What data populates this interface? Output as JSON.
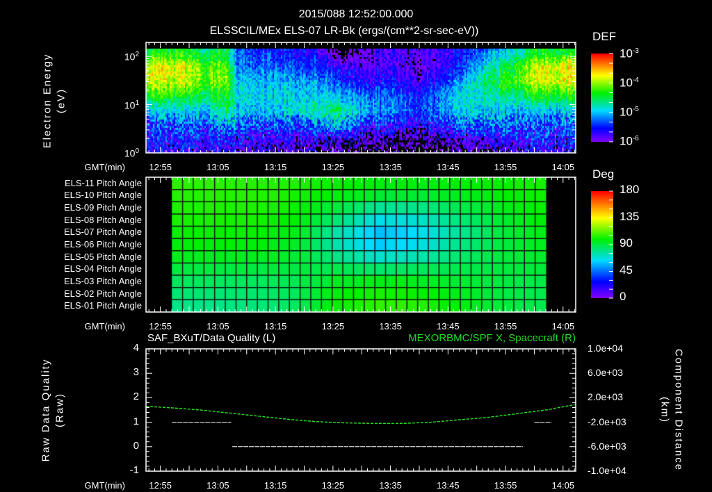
{
  "header": {
    "timestamp": "2015/088 12:52:00.000",
    "title": "ELSSCIL/MEx ELS-07 LR-Bk  (ergs/(cm**2-sr-sec-eV))"
  },
  "time_axis": {
    "label": "GMT(min)",
    "start_min": 0.5,
    "end_min": 75.2,
    "origin": "12:52",
    "ticks": [
      {
        "label": "12:55",
        "min": 3
      },
      {
        "label": "13:05",
        "min": 13
      },
      {
        "label": "13:15",
        "min": 23
      },
      {
        "label": "13:25",
        "min": 33
      },
      {
        "label": "13:35",
        "min": 43
      },
      {
        "label": "13:45",
        "min": 53
      },
      {
        "label": "13:55",
        "min": 63
      },
      {
        "label": "14:05",
        "min": 73
      }
    ]
  },
  "chart_data": [
    {
      "type": "heatmap",
      "name": "electron-spectrogram",
      "ylabel": "Electron Energy",
      "yunit": "(eV)",
      "yscale": "log",
      "ylim_log10": [
        0,
        2.29
      ],
      "yticks": [
        {
          "label": "10",
          "exp": "0",
          "log": 0
        },
        {
          "label": "10",
          "exp": "1",
          "log": 1
        },
        {
          "label": "10",
          "exp": "2",
          "log": 2
        }
      ],
      "data_top_log10E": 2.16,
      "colorbar": {
        "label": "DEF",
        "range_log10": [
          -6,
          -3
        ],
        "ticks": [
          {
            "label": "10",
            "exp": "-3",
            "log": -3
          },
          {
            "label": "10",
            "exp": "-4",
            "log": -4
          },
          {
            "label": "10",
            "exp": "-5",
            "log": -5
          },
          {
            "label": "10",
            "exp": "-6",
            "log": -6
          }
        ]
      },
      "times_min": [
        0,
        6,
        11,
        14.5,
        16,
        23,
        30,
        34,
        38,
        43,
        48,
        55,
        62,
        68,
        75
      ],
      "log10E": [
        0.0,
        0.3,
        0.6,
        0.9,
        1.2,
        1.5,
        1.8,
        2.1
      ],
      "log10_def": [
        [
          -5.8,
          -5.6,
          -5.4,
          -5.0,
          -4.4,
          -3.9,
          -3.8,
          -4.5
        ],
        [
          -5.8,
          -5.6,
          -5.4,
          -5.0,
          -4.4,
          -3.9,
          -3.8,
          -4.4
        ],
        [
          -5.8,
          -5.6,
          -5.4,
          -5.0,
          -4.5,
          -4.2,
          -4.2,
          -4.6
        ],
        [
          -5.8,
          -5.5,
          -5.0,
          -4.5,
          -4.3,
          -4.0,
          -4.1,
          -4.5
        ],
        [
          -5.9,
          -5.7,
          -5.3,
          -5.0,
          -4.9,
          -5.0,
          -5.2,
          -5.3
        ],
        [
          -6.0,
          -5.8,
          -5.4,
          -5.0,
          -4.9,
          -5.0,
          -5.3,
          -5.5
        ],
        [
          -6.1,
          -5.8,
          -5.2,
          -4.7,
          -4.9,
          -5.1,
          -5.4,
          -5.6
        ],
        [
          -6.2,
          -5.9,
          -5.0,
          -4.6,
          -5.0,
          -5.4,
          -5.7,
          -6.3
        ],
        [
          -6.3,
          -6.0,
          -5.5,
          -5.0,
          -5.2,
          -5.6,
          -5.9,
          -6.0
        ],
        [
          -6.4,
          -6.1,
          -5.6,
          -5.2,
          -5.3,
          -5.6,
          -5.8,
          -5.8
        ],
        [
          -6.4,
          -6.2,
          -5.8,
          -5.4,
          -5.5,
          -5.8,
          -6.0,
          -5.9
        ],
        [
          -6.2,
          -5.9,
          -5.3,
          -4.9,
          -4.9,
          -5.1,
          -5.5,
          -5.6
        ],
        [
          -6.0,
          -5.7,
          -5.3,
          -5.0,
          -4.7,
          -4.4,
          -4.6,
          -5.0
        ],
        [
          -5.8,
          -5.6,
          -5.4,
          -5.0,
          -4.4,
          -3.9,
          -3.9,
          -4.5
        ],
        [
          -5.8,
          -5.6,
          -5.4,
          -5.0,
          -4.4,
          -3.8,
          -3.7,
          -4.4
        ]
      ]
    },
    {
      "type": "heatmap",
      "name": "pitch-angle",
      "rows": [
        "ELS-11 Pitch Angle",
        "ELS-10 Pitch Angle",
        "ELS-09 Pitch Angle",
        "ELS-08 Pitch Angle",
        "ELS-07 Pitch Angle",
        "ELS-06 Pitch Angle",
        "ELS-05 Pitch Angle",
        "ELS-04 Pitch Angle",
        "ELS-03 Pitch Angle",
        "ELS-02 Pitch Angle",
        "ELS-01 Pitch Angle"
      ],
      "time_range_min": [
        5,
        70
      ],
      "n_cells": 35,
      "colorbar": {
        "label": "Deg",
        "range": [
          0,
          180
        ],
        "ticks": [
          "180",
          "135",
          "90",
          "45",
          "0"
        ]
      },
      "values_deg": [
        [
          105,
          105,
          104,
          103,
          100,
          97,
          97,
          98,
          100,
          102
        ],
        [
          104,
          104,
          104,
          102,
          97,
          92,
          92,
          95,
          98,
          101
        ],
        [
          103,
          103,
          103,
          100,
          90,
          78,
          80,
          88,
          95,
          100
        ],
        [
          102,
          102,
          102,
          98,
          82,
          66,
          70,
          82,
          92,
          98
        ],
        [
          100,
          100,
          100,
          95,
          75,
          58,
          64,
          78,
          90,
          96
        ],
        [
          98,
          98,
          98,
          93,
          74,
          60,
          66,
          80,
          90,
          95
        ],
        [
          95,
          95,
          95,
          92,
          80,
          70,
          74,
          84,
          90,
          93
        ],
        [
          90,
          90,
          90,
          90,
          88,
          84,
          86,
          88,
          90,
          91
        ],
        [
          86,
          86,
          86,
          88,
          94,
          96,
          95,
          92,
          90,
          89
        ],
        [
          83,
          83,
          84,
          87,
          98,
          102,
          100,
          95,
          90,
          88
        ],
        [
          80,
          80,
          82,
          86,
          100,
          106,
          104,
          97,
          91,
          88
        ]
      ]
    },
    {
      "type": "line",
      "name": "quality-and-position",
      "left_title": "SAF_BXuT/Data Quality (L)",
      "right_title": "MEXORBMC/SPF X, Spacecraft (R)",
      "ylabel_left": "Raw Data Quality",
      "yunit_left": "(Raw)",
      "ylabel_right": "Component Distance",
      "yunit_right": "(km)",
      "ylim_left": [
        -1,
        4
      ],
      "ylim_right": [
        -10000,
        10000
      ],
      "yticks_left": [
        "4",
        "3",
        "2",
        "1",
        "0",
        "-1"
      ],
      "yticks_right": [
        "1.0e+04",
        "6.0e+03",
        "2.0e+03",
        "-2.0e+03",
        "-6.0e+03",
        "-1.0e+04"
      ],
      "series": [
        {
          "name": "Data Quality",
          "axis": "left",
          "color": "#ffffff",
          "segments": [
            {
              "from": 5,
              "to": 15.3,
              "value": 1
            },
            {
              "from": 15.5,
              "to": 66,
              "value": 0
            },
            {
              "from": 68,
              "to": 71,
              "value": 1
            }
          ]
        },
        {
          "name": "SPF X Spacecraft",
          "axis": "right",
          "color": "#22dd22",
          "points": [
            [
              0.5,
              600
            ],
            [
              5,
              350
            ],
            [
              10,
              0
            ],
            [
              15,
              -500
            ],
            [
              20,
              -1000
            ],
            [
              25,
              -1500
            ],
            [
              30,
              -1900
            ],
            [
              35,
              -2100
            ],
            [
              40,
              -2200
            ],
            [
              45,
              -2200
            ],
            [
              50,
              -2000
            ],
            [
              55,
              -1600
            ],
            [
              60,
              -1200
            ],
            [
              65,
              -600
            ],
            [
              70,
              0
            ],
            [
              75.2,
              900
            ]
          ]
        }
      ]
    }
  ]
}
